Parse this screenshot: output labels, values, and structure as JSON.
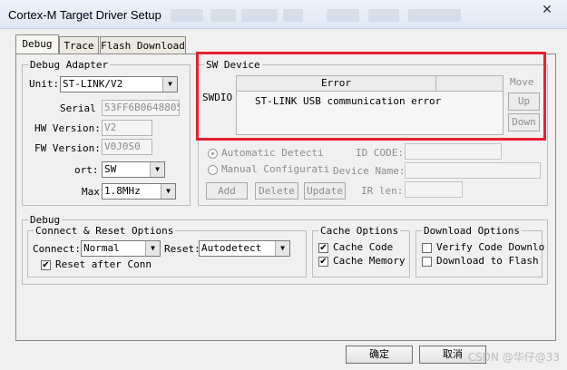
{
  "window": {
    "title": "Cortex-M Target Driver Setup",
    "close_glyph": "✕"
  },
  "tabs": [
    {
      "label": "Debug",
      "active": true
    },
    {
      "label": "Trace",
      "active": false
    },
    {
      "label": "Flash Download",
      "active": false
    }
  ],
  "debug_adapter": {
    "legend": "Debug Adapter",
    "unit_label": "Unit:",
    "unit_value": "ST-LINK/V2",
    "serial_label": "Serial",
    "serial_value": "53FF6B06488057",
    "hw_label": "HW Version:",
    "hw_value": "V2",
    "fw_label": "FW Version:",
    "fw_value": "V0J0S0",
    "port_label": "ort:",
    "port_value": "SW",
    "max_label": "Max",
    "max_value": "1.8MHz"
  },
  "sw_device": {
    "legend": "SW Device",
    "row_label": "SWDIO",
    "column_header": "Error",
    "error_text": "ST-LINK USB communication error",
    "move_label": "Move",
    "up_label": "Up",
    "down_label": "Down",
    "auto_label": "Automatic Detecti",
    "manual_label": "Manual Configurati",
    "id_code_label": "ID CODE:",
    "device_name_label": "Device Name:",
    "ir_len_label": "IR len:",
    "add_label": "Add",
    "delete_label": "Delete",
    "update_label": "Update"
  },
  "debug": {
    "legend": "Debug",
    "connect_reset": {
      "legend": "Connect & Reset Options",
      "connect_label": "Connect:",
      "connect_value": "Normal",
      "reset_label": "Reset:",
      "reset_value": "Autodetect",
      "reset_after_label": "Reset after Conn",
      "reset_after_checked": true
    },
    "cache": {
      "legend": "Cache Options",
      "code_label": "Cache Code",
      "code_checked": true,
      "memory_label": "Cache Memory",
      "memory_checked": true
    },
    "download": {
      "legend": "Download Options",
      "verify_label": "Verify Code Downlo",
      "verify_checked": false,
      "flash_label": "Download to Flash",
      "flash_checked": false
    }
  },
  "footer": {
    "ok_label": "确定",
    "cancel_label": "取消",
    "watermark": "CSDN @华仔@33"
  }
}
